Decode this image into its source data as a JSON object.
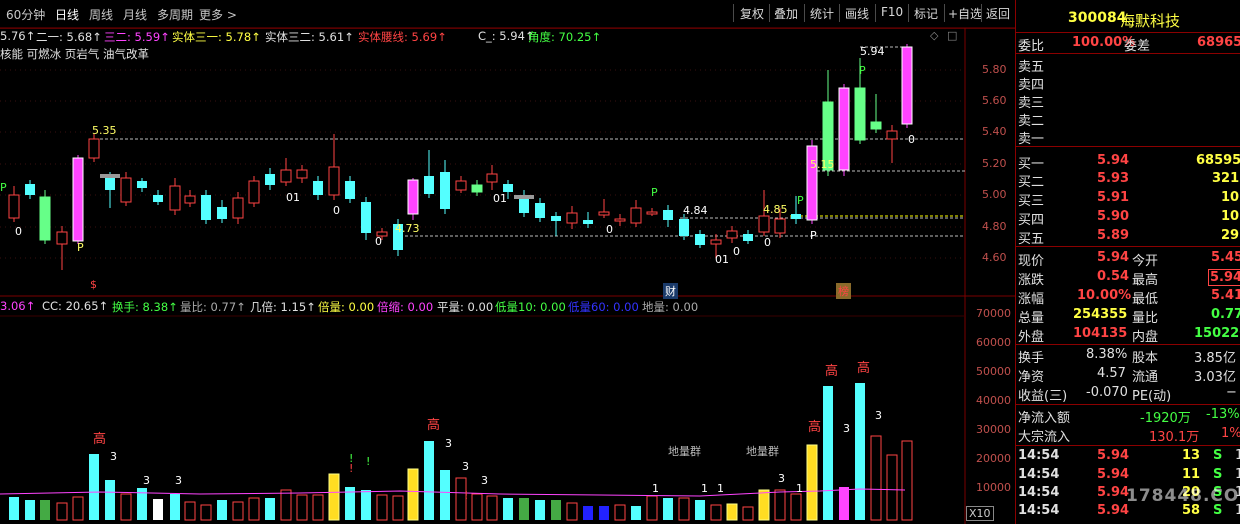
{
  "toolbar": {
    "tabs": [
      {
        "label": "60分钟",
        "active": false
      },
      {
        "label": "日线",
        "active": true
      },
      {
        "label": "周线",
        "active": false
      },
      {
        "label": "月线",
        "active": false
      },
      {
        "label": "多周期",
        "active": false
      },
      {
        "label": "更多 >",
        "active": false
      }
    ],
    "buttons": [
      "复权",
      "叠加",
      "统计",
      "画线",
      "F10",
      "标记",
      "+自选",
      "返回"
    ]
  },
  "price_indicators": [
    {
      "text": "5.76↑",
      "color": "#e0e0e0"
    },
    {
      "text": "二一: 5.68↑",
      "color": "#e0e0e0"
    },
    {
      "text": "三二: 5.59↑",
      "color": "#ff44ff"
    },
    {
      "text": "实体三一: 5.78↑",
      "color": "#ffff44"
    },
    {
      "text": "实体三二: 5.61↑",
      "color": "#e0e0e0"
    },
    {
      "text": "实体腰线: 5.69↑",
      "color": "#ff4444"
    },
    {
      "text": "C_: 5.94↑",
      "color": "#e0e0e0"
    },
    {
      "text": "角度: 70.25↑",
      "color": "#44ff44"
    }
  ],
  "concept_text": "核能 可燃冰 页岩气 油气改革",
  "volume_indicators": [
    {
      "text": "3.06↑",
      "color": "#ff44ff"
    },
    {
      "text": "CC: 20.65↑",
      "color": "#e0e0e0"
    },
    {
      "text": "换手: 8.38↑",
      "color": "#44ff44"
    },
    {
      "text": "量比: 0.77↑",
      "color": "#aaaaaa"
    },
    {
      "text": "几倍: 1.15↑",
      "color": "#e0e0e0"
    },
    {
      "text": "倍量: 0.00",
      "color": "#ffff44"
    },
    {
      "text": "倍缩: 0.00",
      "color": "#ff44ff"
    },
    {
      "text": "平量: 0.00",
      "color": "#e0e0e0"
    },
    {
      "text": "低量10: 0.00",
      "color": "#44ff44"
    },
    {
      "text": "低量60: 0.00",
      "color": "#3333ff"
    },
    {
      "text": "地量: 0.00",
      "color": "#aaaaaa"
    }
  ],
  "price_axis": [
    "5.80",
    "5.60",
    "5.40",
    "5.20",
    "5.00",
    "4.80",
    "4.60"
  ],
  "volume_axis": [
    "70000",
    "60000",
    "50000",
    "40000",
    "30000",
    "20000",
    "10000"
  ],
  "volume_axis_unit": "X10",
  "chart_markers": {
    "dollar": "$",
    "cai": "财",
    "bang": "榜",
    "label_535": "5.35",
    "label_594": "5.94",
    "label_515": "5.15",
    "label_484": "4.84",
    "label_485": "4.85",
    "label_473": "4.73",
    "p": "P",
    "zero": "0",
    "zero_one": "01",
    "gao": "高",
    "three": "3",
    "diliang": "地量群",
    "one": "1",
    "excl": "!"
  },
  "stock": {
    "code": "300084",
    "name": "海默科技"
  },
  "order_book": {
    "weibi_label": "委比",
    "weibi_value": "100.00%",
    "weicha_label": "委差",
    "weicha_value": "68965",
    "sells": [
      {
        "label": "卖五"
      },
      {
        "label": "卖四"
      },
      {
        "label": "卖三"
      },
      {
        "label": "卖二"
      },
      {
        "label": "卖一"
      }
    ],
    "buys": [
      {
        "label": "买一",
        "price": "5.94",
        "vol": "68595"
      },
      {
        "label": "买二",
        "price": "5.93",
        "vol": "321"
      },
      {
        "label": "买三",
        "price": "5.91",
        "vol": "10"
      },
      {
        "label": "买四",
        "price": "5.90",
        "vol": "10"
      },
      {
        "label": "买五",
        "price": "5.89",
        "vol": "29"
      }
    ]
  },
  "quote": [
    {
      "l1": "现价",
      "v1": "5.94",
      "l2": "今开",
      "v2": "5.45",
      "c1": "#ff4444",
      "c2": "#ff4444"
    },
    {
      "l1": "涨跌",
      "v1": "0.54",
      "l2": "最高",
      "v2": "5.94",
      "c1": "#ff4444",
      "c2": "#ff4444"
    },
    {
      "l1": "涨幅",
      "v1": "10.00%",
      "l2": "最低",
      "v2": "5.41",
      "c1": "#ff4444",
      "c2": "#ff4444"
    },
    {
      "l1": "总量",
      "v1": "254355",
      "l2": "量比",
      "v2": "0.77",
      "c1": "#ffff44",
      "c2": "#44ff44"
    },
    {
      "l1": "外盘",
      "v1": "104135",
      "l2": "内盘",
      "v2": "150220",
      "c1": "#ff4444",
      "c2": "#44ff44"
    }
  ],
  "fundamentals": [
    {
      "l1": "换手",
      "v1": "8.38%",
      "l2": "股本",
      "v2": "3.85亿"
    },
    {
      "l1": "净资",
      "v1": "4.57",
      "l2": "流通",
      "v2": "3.03亿"
    },
    {
      "l1": "收益(三)",
      "v1": "-0.070",
      "l2": "PE(动)",
      "v2": "−"
    }
  ],
  "flows": [
    {
      "label": "净流入额",
      "v1": "-1920万",
      "v2": "-13%",
      "c": "#44ff44"
    },
    {
      "label": "大宗流入",
      "v1": "130.1万",
      "v2": "1%",
      "c": "#ff4444"
    }
  ],
  "ticks": [
    {
      "time": "14:54",
      "price": "5.94",
      "vol": "13",
      "side": "S",
      "n": "1"
    },
    {
      "time": "14:54",
      "price": "5.94",
      "vol": "11",
      "side": "S",
      "n": "1"
    },
    {
      "time": "14:54",
      "price": "5.94",
      "vol": "20",
      "side": "S",
      "n": "1"
    },
    {
      "time": "14:54",
      "price": "5.94",
      "vol": "58",
      "side": "S",
      "n": "1"
    }
  ],
  "watermark": "178448.COM"
}
